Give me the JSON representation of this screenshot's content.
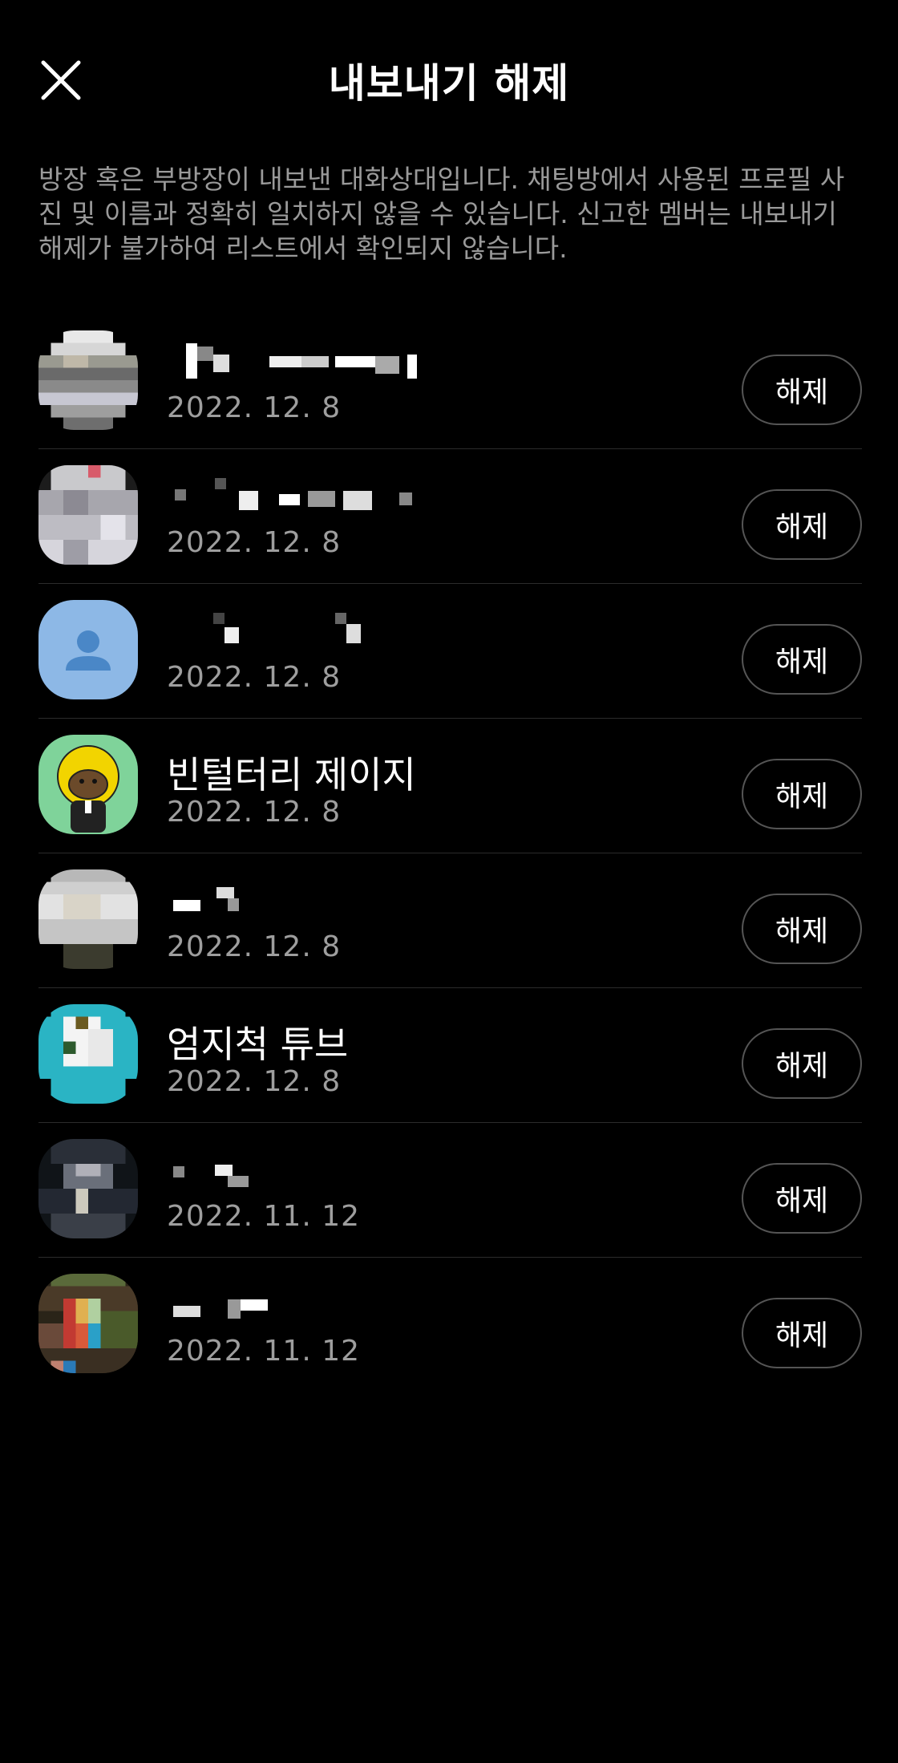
{
  "header": {
    "title": "내보내기 해제",
    "close_icon": "close-icon"
  },
  "description": "방장 혹은 부방장이 내보낸 대화상대입니다. 채팅방에서 사용된 프로필 사진 및 이름과 정확히 일치하지 않을 수 있습니다. 신고한 멤버는 내보내기 해제가 불가하여 리스트에서 확인되지 않습니다.",
  "members": [
    {
      "name": "",
      "date": "2022. 12. 8",
      "button": "해제",
      "avatar": "pixelated-photo"
    },
    {
      "name": "",
      "date": "2022. 12. 8",
      "button": "해제",
      "avatar": "pixelated-photo"
    },
    {
      "name": "",
      "date": "2022. 12. 8",
      "button": "해제",
      "avatar": "default-person-icon"
    },
    {
      "name": "빈털터리 제이지",
      "date": "2022. 12. 8",
      "button": "해제",
      "avatar": "character-avatar"
    },
    {
      "name": "",
      "date": "2022. 12. 8",
      "button": "해제",
      "avatar": "pixelated-photo"
    },
    {
      "name": "엄지척 튜브",
      "date": "2022. 12. 8",
      "button": "해제",
      "avatar": "character-avatar"
    },
    {
      "name": "",
      "date": "2022. 11. 12",
      "button": "해제",
      "avatar": "pixelated-photo"
    },
    {
      "name": "",
      "date": "2022. 11. 12",
      "button": "해제",
      "avatar": "pixelated-photo"
    }
  ],
  "colors": {
    "background": "#000000",
    "default_avatar_bg": "#8db8e6",
    "default_avatar_fg": "#4a87c7",
    "character1_bg": "#7fd39a",
    "character1_hair": "#f2d400",
    "character2_bg": "#2ab4c4"
  }
}
